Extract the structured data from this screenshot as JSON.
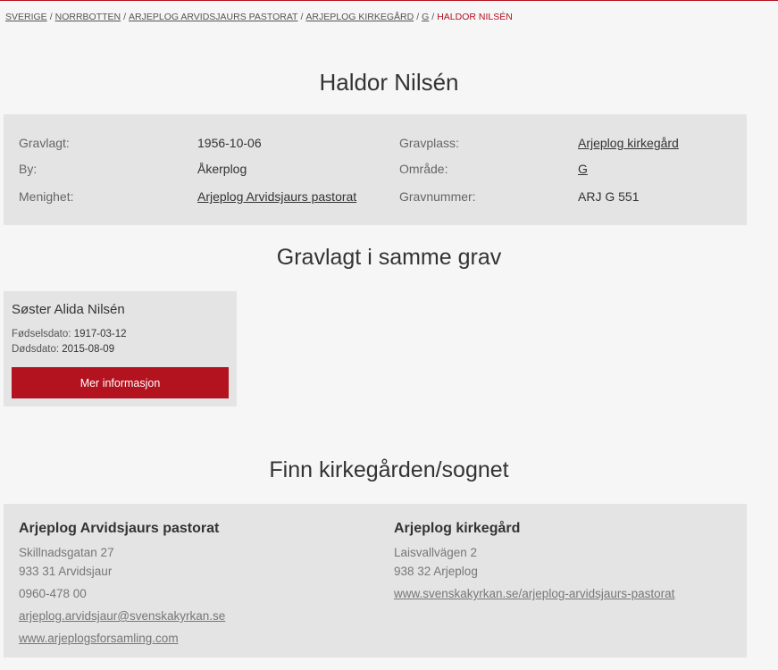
{
  "breadcrumb": {
    "items": [
      "SVERIGE",
      "NORRBOTTEN",
      "ARJEPLOG ARVIDSJAURS PASTORAT",
      "ARJEPLOG KIRKEGÅRD",
      "G"
    ],
    "current": "HALDOR NILSÉN",
    "separator": "/"
  },
  "title": "Haldor Nilsén",
  "info": {
    "gravlagt_label": "Gravlagt:",
    "gravlagt_value": "1956-10-06",
    "by_label": "By:",
    "by_value": "Åkerplog",
    "menighet_label": "Menighet:",
    "menighet_value": "Arjeplog Arvidsjaurs pastorat",
    "gravplass_label": "Gravplass:",
    "gravplass_value": "Arjeplog kirkegård",
    "omrade_label": "Område:",
    "omrade_value": "G",
    "gravnummer_label": "Gravnummer:",
    "gravnummer_value": "ARJ G 551"
  },
  "same_grave": {
    "heading": "Gravlagt i samme grav",
    "person": {
      "name": "Søster Alida Nilsén",
      "birth_label": "Fødselsdato:",
      "birth_value": "1917-03-12",
      "death_label": "Dødsdato:",
      "death_value": "2015-08-09",
      "button_label": "Mer informasjon"
    }
  },
  "find": {
    "heading": "Finn kirkegården/sognet",
    "parish": {
      "name": "Arjeplog Arvidsjaurs pastorat",
      "street": "Skillnadsgatan 27",
      "city": "933 31 Arvidsjaur",
      "phone": "0960-478 00",
      "email": "arjeplog.arvidsjaur@svenskakyrkan.se",
      "website": "www.arjeplogsforsamling.com"
    },
    "cemetery": {
      "name": "Arjeplog kirkegård",
      "street": "Laisvallvägen 2",
      "city": "938 32 Arjeplog",
      "website": "www.svenskakyrkan.se/arjeplog-arvidsjaurs-pastorat"
    }
  },
  "colors": {
    "accent": "#b3121f",
    "panel": "#e4e4e4",
    "background": "#f6f6f6"
  }
}
